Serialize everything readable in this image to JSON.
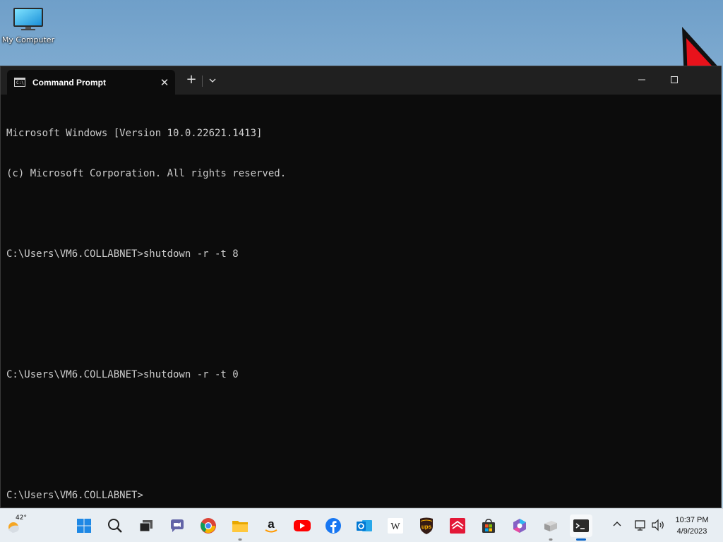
{
  "desktop": {
    "icons": [
      {
        "label": "My Computer"
      }
    ]
  },
  "terminal": {
    "tab_title": "Command Prompt",
    "tab_close": "✕",
    "new_tab": "+",
    "lines": [
      "Microsoft Windows [Version 10.0.22621.1413]",
      "(c) Microsoft Corporation. All rights reserved.",
      "",
      "C:\\Users\\VM6.COLLABNET>shutdown -r -t 8",
      "",
      "",
      "C:\\Users\\VM6.COLLABNET>shutdown -r -t 0",
      "",
      "",
      "C:\\Users\\VM6.COLLABNET>"
    ]
  },
  "taskbar": {
    "weather_temp": "42°",
    "apps": [
      "start-icon",
      "search-icon",
      "task-view-icon",
      "chat-icon",
      "chrome-icon",
      "file-explorer-icon",
      "amazon-icon",
      "youtube-icon",
      "facebook-icon",
      "outlook-icon",
      "wikipedia-icon",
      "ups-icon",
      "bank-of-america-icon",
      "microsoft-store-icon",
      "copilot-icon",
      "system-tool-icon",
      "terminal-icon"
    ],
    "clock": {
      "time": "10:37 PM",
      "date": "4/9/2023"
    }
  },
  "colors": {
    "terminal_bg": "#0c0c0c",
    "terminal_text": "#cccccc",
    "titlebar_bg": "#202020",
    "taskbar_bg": "#e8eef3",
    "accent": "#0a64c8"
  }
}
